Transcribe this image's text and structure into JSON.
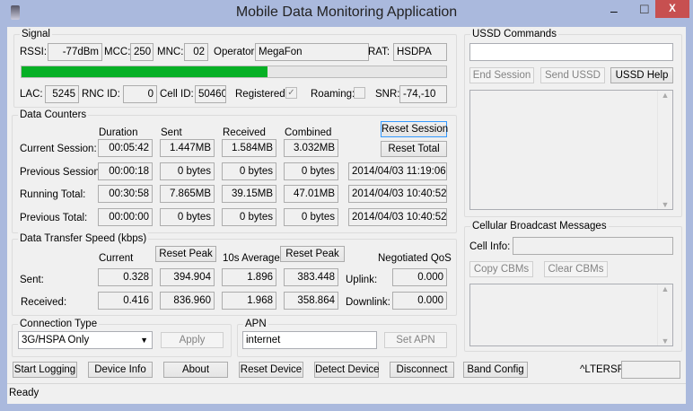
{
  "window": {
    "title": "Mobile Data Monitoring Application",
    "minimize": "–",
    "maximize": "☐",
    "close": "X"
  },
  "signal": {
    "label": "Signal",
    "rssi_label": "RSSI:",
    "rssi": "-77dBm",
    "mcc_label": "MCC:",
    "mcc": "250",
    "mnc_label": "MNC:",
    "mnc": "02",
    "operator_label": "Operator:",
    "operator": "MegaFon",
    "rat_label": "RAT:",
    "rat": "HSDPA",
    "strength_fraction": 0.58,
    "strength_color": "#06b025",
    "lac_label": "LAC:",
    "lac": "5245",
    "rnc_label": "RNC ID:",
    "rnc": "0",
    "cell_label": "Cell ID:",
    "cell": "50460",
    "registered_label": "Registered:",
    "registered": true,
    "roaming_label": "Roaming:",
    "roaming": false,
    "snr_label": "SNR:",
    "snr": "-74,-10"
  },
  "counters": {
    "label": "Data Counters",
    "headers": [
      "Duration",
      "Sent",
      "Received",
      "Combined"
    ],
    "reset_session": "Reset Session",
    "reset_total": "Reset Total",
    "rows": [
      {
        "label": "Current Session:",
        "values": [
          "00:05:42",
          "1.447MB",
          "1.584MB",
          "3.032MB"
        ]
      },
      {
        "label": "Previous Session:",
        "values": [
          "00:00:18",
          "0 bytes",
          "0 bytes",
          "0 bytes"
        ],
        "date": "2014/04/03 11:19:06"
      },
      {
        "label": "Running Total:",
        "values": [
          "00:30:58",
          "7.865MB",
          "39.15MB",
          "47.01MB"
        ],
        "date": "2014/04/03 10:40:52"
      },
      {
        "label": "Previous Total:",
        "values": [
          "00:00:00",
          "0 bytes",
          "0 bytes",
          "0 bytes"
        ],
        "date": "2014/04/03 10:40:52"
      }
    ]
  },
  "speed": {
    "label": "Data Transfer Speed (kbps)",
    "current": "Current",
    "reset_peak": "Reset Peak",
    "avg": "10s Average",
    "qos": "Negotiated QoS",
    "sent_label": "Sent:",
    "sent": [
      "0.328",
      "394.904",
      "1.896",
      "383.448"
    ],
    "uplink_label": "Uplink:",
    "uplink": "0.000",
    "recv_label": "Received:",
    "recv": [
      "0.416",
      "836.960",
      "1.968",
      "358.864"
    ],
    "downlink_label": "Downlink:",
    "downlink": "0.000"
  },
  "connection": {
    "label": "Connection Type",
    "value": "3G/HSPA Only",
    "apply": "Apply"
  },
  "apn": {
    "label": "APN",
    "value": "internet",
    "set": "Set APN"
  },
  "buttons": [
    "Start Logging",
    "Device Info",
    "About",
    "Reset Device",
    "Detect Device",
    "Disconnect",
    "Band Config"
  ],
  "ltersrp_label": "^LTERSRP:",
  "ussd": {
    "label": "USSD Commands",
    "input": "",
    "end": "End Session",
    "send": "Send USSD",
    "help": "USSD Help"
  },
  "cbm": {
    "label": "Cellular Broadcast Messages",
    "cell_info_label": "Cell Info:",
    "cell_info": "",
    "copy": "Copy CBMs",
    "clear": "Clear CBMs"
  },
  "status": "Ready"
}
